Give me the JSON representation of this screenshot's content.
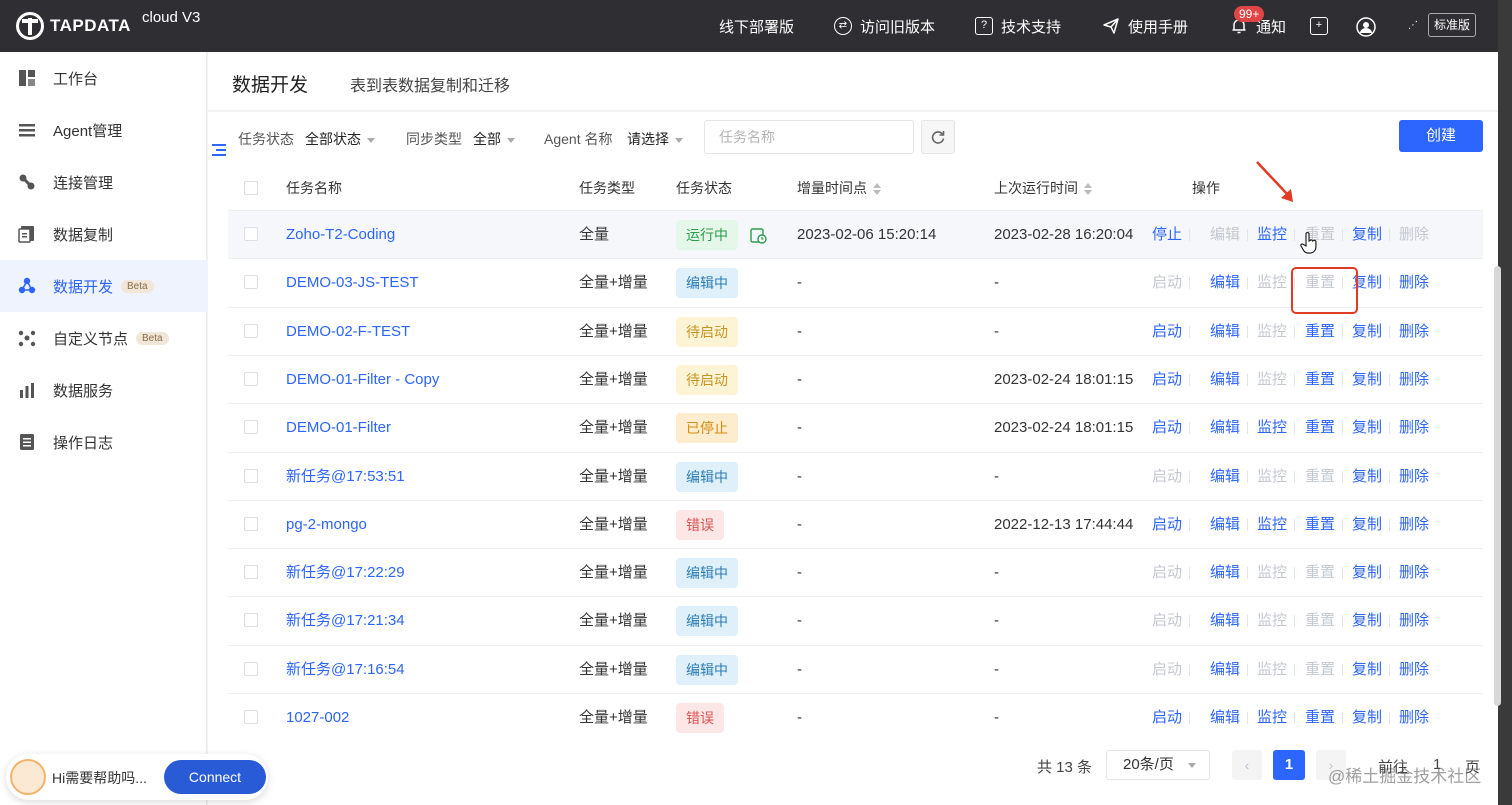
{
  "topbar": {
    "brand": "TAPDATA",
    "edition": "cloud V3",
    "offline_deploy": "线下部署版",
    "old_version": "访问旧版本",
    "tech_support": "技术支持",
    "manual": "使用手册",
    "notify": "通知",
    "notify_badge": "99+",
    "plan": "标准版"
  },
  "sidebar": {
    "items": [
      {
        "label": "工作台",
        "icon": "dashboard-icon"
      },
      {
        "label": "Agent管理",
        "icon": "agent-list-icon"
      },
      {
        "label": "连接管理",
        "icon": "link-icon"
      },
      {
        "label": "数据复制",
        "icon": "copy-icon"
      },
      {
        "label": "数据开发",
        "icon": "dev-nodes-icon",
        "badge": "Beta"
      },
      {
        "label": "自定义节点",
        "icon": "custom-node-icon",
        "badge": "Beta"
      },
      {
        "label": "数据服务",
        "icon": "bar-chart-icon"
      },
      {
        "label": "操作日志",
        "icon": "log-icon"
      }
    ]
  },
  "header": {
    "title": "数据开发",
    "subtitle": "表到表数据复制和迁移"
  },
  "filters": {
    "status_label": "任务状态",
    "status_value": "全部状态",
    "sync_label": "同步类型",
    "sync_value": "全部",
    "agent_label": "Agent 名称",
    "agent_value": "请选择",
    "search_placeholder": "任务名称",
    "create": "创建"
  },
  "table": {
    "columns": [
      "任务名称",
      "任务类型",
      "任务状态",
      "增量时间点",
      "上次运行时间",
      "操作"
    ],
    "rows": [
      {
        "name": "Zoho-T2-Coding",
        "type": "全量",
        "status": "运行中",
        "cls": "t-run",
        "incr": "2023-02-06 15:20:14",
        "last": "2023-02-28 16:20:04",
        "first_op": "停止",
        "ops": [
          1,
          0,
          1,
          0,
          1,
          0
        ]
      },
      {
        "name": "DEMO-03-JS-TEST",
        "type": "全量+增量",
        "status": "编辑中",
        "cls": "t-edit",
        "incr": "-",
        "last": "-",
        "first_op": "启动",
        "ops": [
          0,
          1,
          0,
          0,
          1,
          1
        ]
      },
      {
        "name": "DEMO-02-F-TEST",
        "type": "全量+增量",
        "status": "待启动",
        "cls": "t-wait",
        "incr": "-",
        "last": "-",
        "first_op": "启动",
        "ops": [
          1,
          1,
          0,
          1,
          1,
          1
        ]
      },
      {
        "name": "DEMO-01-Filter - Copy",
        "type": "全量+增量",
        "status": "待启动",
        "cls": "t-wait",
        "incr": "-",
        "last": "2023-02-24 18:01:15",
        "first_op": "启动",
        "ops": [
          1,
          1,
          0,
          1,
          1,
          1
        ]
      },
      {
        "name": "DEMO-01-Filter",
        "type": "全量+增量",
        "status": "已停止",
        "cls": "t-stop",
        "incr": "-",
        "last": "2023-02-24 18:01:15",
        "first_op": "启动",
        "ops": [
          1,
          1,
          1,
          1,
          1,
          1
        ]
      },
      {
        "name": "新任务@17:53:51",
        "type": "全量+增量",
        "status": "编辑中",
        "cls": "t-edit",
        "incr": "-",
        "last": "-",
        "first_op": "启动",
        "ops": [
          0,
          1,
          0,
          0,
          1,
          1
        ]
      },
      {
        "name": "pg-2-mongo",
        "type": "全量+增量",
        "status": "错误",
        "cls": "t-err",
        "incr": "-",
        "last": "2022-12-13 17:44:44",
        "first_op": "启动",
        "ops": [
          1,
          1,
          1,
          1,
          1,
          1
        ]
      },
      {
        "name": "新任务@17:22:29",
        "type": "全量+增量",
        "status": "编辑中",
        "cls": "t-edit",
        "incr": "-",
        "last": "-",
        "first_op": "启动",
        "ops": [
          0,
          1,
          0,
          0,
          1,
          1
        ]
      },
      {
        "name": "新任务@17:21:34",
        "type": "全量+增量",
        "status": "编辑中",
        "cls": "t-edit",
        "incr": "-",
        "last": "-",
        "first_op": "启动",
        "ops": [
          0,
          1,
          0,
          0,
          1,
          1
        ]
      },
      {
        "name": "新任务@17:16:54",
        "type": "全量+增量",
        "status": "编辑中",
        "cls": "t-edit",
        "incr": "-",
        "last": "-",
        "first_op": "启动",
        "ops": [
          0,
          1,
          0,
          0,
          1,
          1
        ]
      },
      {
        "name": "1027-002",
        "type": "全量+增量",
        "status": "错误",
        "cls": "t-err",
        "incr": "-",
        "last": "-",
        "first_op": "启动",
        "ops": [
          1,
          1,
          1,
          1,
          1,
          1
        ]
      }
    ],
    "op_labels": [
      "编辑",
      "监控",
      "重置",
      "复制",
      "删除"
    ]
  },
  "pager": {
    "total": "共 13 条",
    "size": "20条/页",
    "current": "1",
    "goto": "前往",
    "page": "1",
    "unit": "页"
  },
  "watermark": "@稀土掘金技术社区",
  "chat": {
    "text": "Hi需要帮助吗...",
    "button": "Connect"
  },
  "colors": {
    "primary": "#2c65ff",
    "topbar": "#2f2f33",
    "highlight": "#e23b25"
  }
}
